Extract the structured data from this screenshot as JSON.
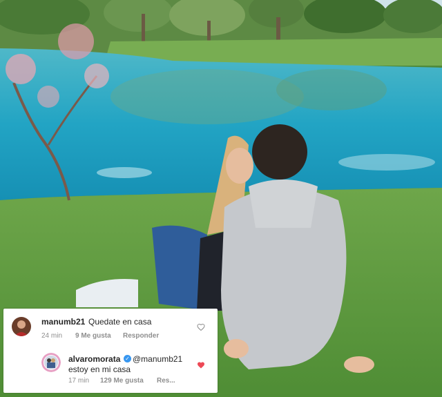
{
  "comments": [
    {
      "username": "manumb21",
      "text": "Quedate en casa",
      "time": "24 min",
      "likes": "9 Me gusta",
      "reply_label": "Responder",
      "liked": false
    },
    {
      "username": "alvaromorata",
      "mention": "@manumb21",
      "text": "estoy en mi casa",
      "time": "17 min",
      "likes": "129 Me gusta",
      "reply_label": "Res...",
      "liked": true,
      "verified": true
    }
  ],
  "icons": {
    "heart_outline": "heart-outline-icon",
    "heart_filled": "heart-filled-icon",
    "verified": "verified-badge-icon"
  },
  "colors": {
    "text": "#262626",
    "meta": "#8e8e8e",
    "like_red": "#ed4956",
    "verified_blue": "#3897f0",
    "water": "#2aa7c0",
    "grass": "#5b9a3f"
  }
}
